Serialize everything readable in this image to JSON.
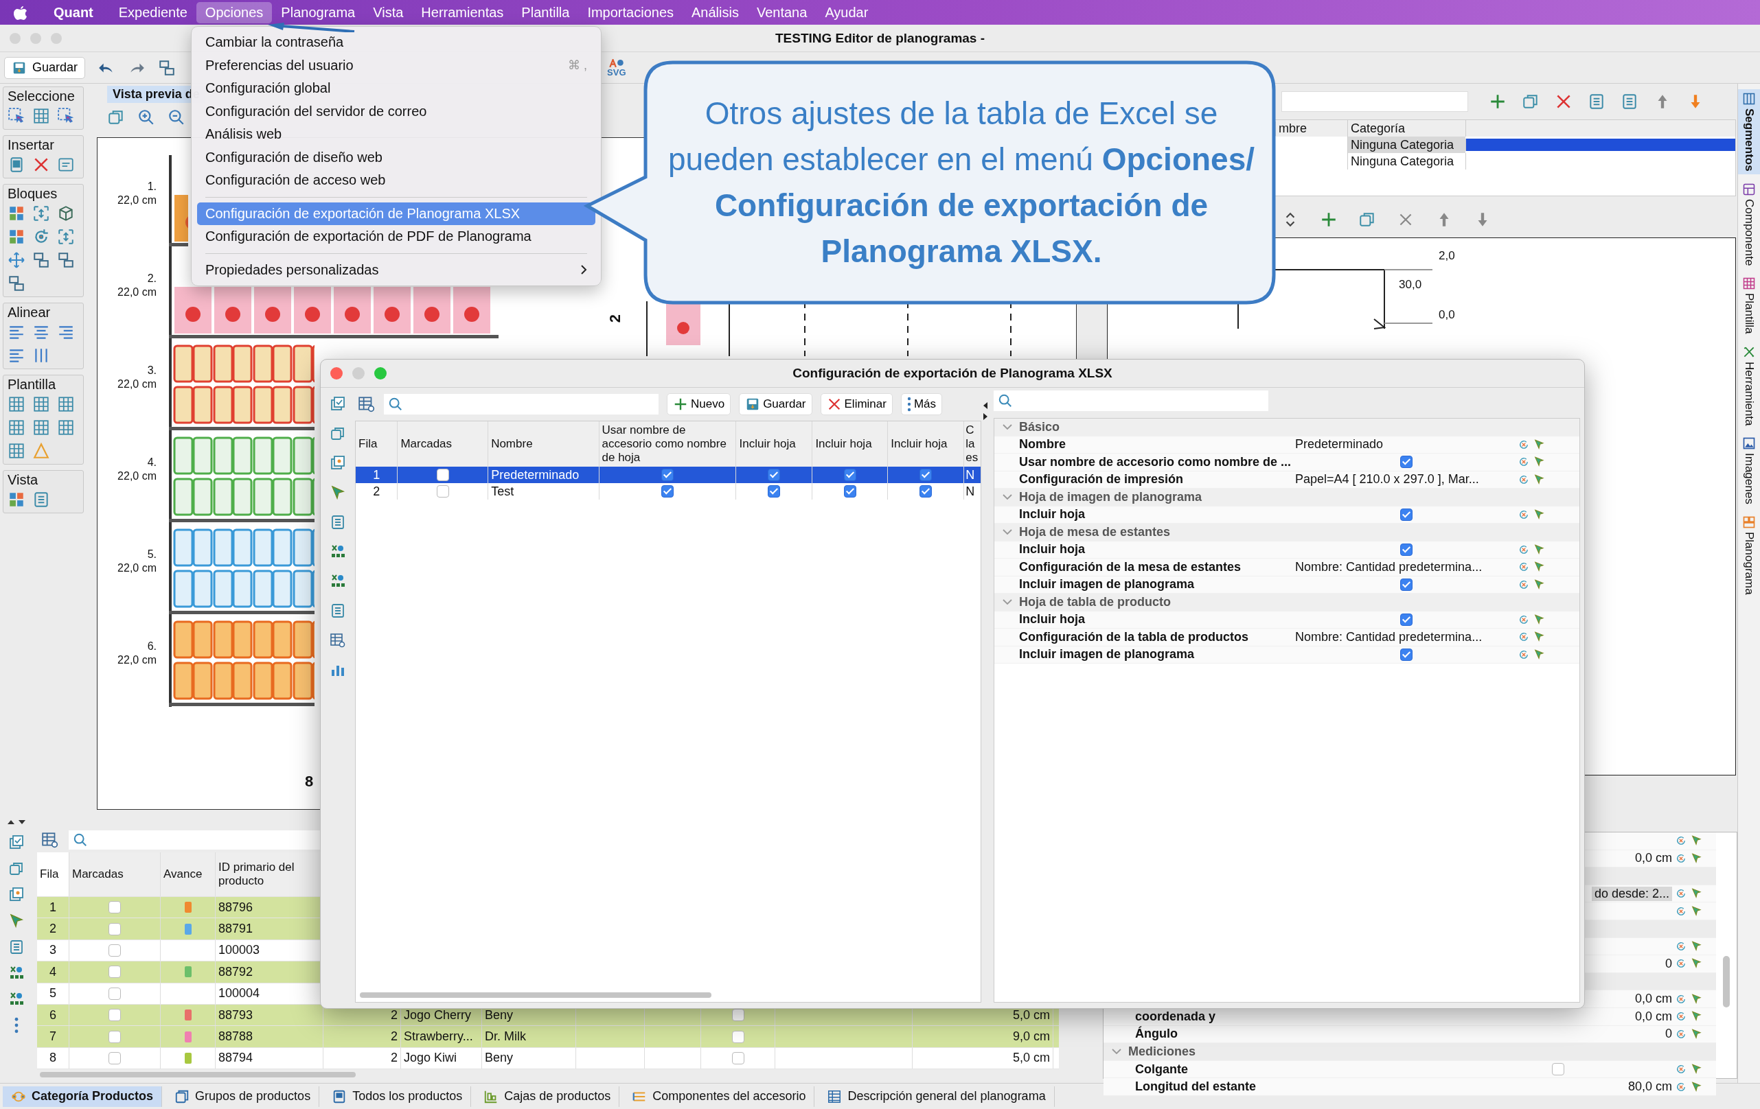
{
  "menu_bar": {
    "app_name": "Quant",
    "items": [
      {
        "label": "Expediente",
        "selected": false
      },
      {
        "label": "Opciones",
        "selected": true
      },
      {
        "label": "Planograma",
        "selected": false
      },
      {
        "label": "Vista",
        "selected": false
      },
      {
        "label": "Herramientas",
        "selected": false
      },
      {
        "label": "Plantilla",
        "selected": false
      },
      {
        "label": "Importaciones",
        "selected": false
      },
      {
        "label": "Análisis",
        "selected": false
      },
      {
        "label": "Ventana",
        "selected": false
      },
      {
        "label": "Ayudar",
        "selected": false
      }
    ]
  },
  "window": {
    "title": "TESTING Editor de planogramas -"
  },
  "toolbar": {
    "save_button": "Guardar",
    "export_badge": "SVG"
  },
  "editor_tab": "Vista previa de",
  "palette": [
    "Seleccione",
    "Insertar",
    "Bloques",
    "Alinear",
    "Plantilla",
    "Vista"
  ],
  "shelves": [
    {
      "number": "1.",
      "height": "22,0 cm",
      "kind": "orange-carton"
    },
    {
      "number": "2.",
      "height": "22,0 cm",
      "kind": "pink-carton"
    },
    {
      "number": "3.",
      "height": "22,0 cm",
      "kind": "red-cup"
    },
    {
      "number": "4.",
      "height": "22,0 cm",
      "kind": "green-cup"
    },
    {
      "number": "5.",
      "height": "22,0 cm",
      "kind": "blue-cup"
    },
    {
      "number": "6.",
      "height": "22,0 cm",
      "kind": "orange-cup"
    }
  ],
  "canvas": {
    "segment_label": "2",
    "width_label": "8"
  },
  "segments_panel": {
    "columns": [
      "mbre",
      "Categoría"
    ],
    "rows": [
      {
        "category": "Ninguna Categoria",
        "selected": true,
        "color": "#1f4fd8"
      },
      {
        "category": "Ninguna Categoria",
        "selected": false
      }
    ]
  },
  "segment_dimensions": [
    "2,0",
    "30,0",
    "0,0"
  ],
  "side_tabs": [
    {
      "label": "Segmentos",
      "selected": true
    },
    {
      "label": "Componente",
      "selected": false
    },
    {
      "label": "Plantilla",
      "selected": false
    },
    {
      "label": "Herramienta",
      "selected": false
    },
    {
      "label": "Imagenes",
      "selected": false
    },
    {
      "label": "Planograma",
      "selected": false
    }
  ],
  "product_table": {
    "columns": [
      "Fila",
      "Marcadas",
      "Avance",
      "ID primario del producto"
    ],
    "rows": [
      {
        "row": "1",
        "marked": false,
        "highlighted": true,
        "color": "#f08a30",
        "id": "88796"
      },
      {
        "row": "2",
        "marked": false,
        "highlighted": true,
        "color": "#5aa8e8",
        "id": "88791"
      },
      {
        "row": "3",
        "marked": false,
        "highlighted": false,
        "id": "100003"
      },
      {
        "row": "4",
        "marked": false,
        "highlighted": true,
        "color": "#6cbf6a",
        "id": "88792"
      },
      {
        "row": "5",
        "marked": false,
        "highlighted": false,
        "id": "100004"
      },
      {
        "row": "6",
        "marked": false,
        "highlighted": true,
        "color": "#e8706a",
        "id": "88793",
        "quantity": "2",
        "name": "Jogo Cherry",
        "brand": "Beny",
        "flag": false,
        "width": "5,0 cm"
      },
      {
        "row": "7",
        "marked": false,
        "highlighted": true,
        "color": "#f080b0",
        "id": "88788",
        "quantity": "2",
        "name": "Strawberry...",
        "brand": "Dr. Milk",
        "flag": false,
        "width": "9,0 cm"
      },
      {
        "row": "8",
        "marked": false,
        "highlighted": false,
        "color": "#a8c840",
        "id": "88794",
        "quantity": "2",
        "name": "Jogo Kiwi",
        "brand": "Beny",
        "flag": false,
        "width": "5,0 cm"
      }
    ]
  },
  "properties_panel": [
    {
      "kind": "empty"
    },
    {
      "kind": "text",
      "value": "0,0 cm"
    },
    {
      "kind": "group"
    },
    {
      "kind": "text",
      "value": "do desde: 2..."
    },
    {
      "kind": "empty"
    },
    {
      "kind": "group"
    },
    {
      "kind": "empty"
    },
    {
      "kind": "text",
      "value": "0"
    },
    {
      "kind": "group"
    },
    {
      "kind": "text",
      "value": "0,0 cm"
    },
    {
      "kind": "text",
      "label": "coordenada y",
      "value": "0,0 cm"
    },
    {
      "kind": "text",
      "label": "Ángulo",
      "value": "0"
    },
    {
      "kind": "group",
      "label": "Mediciones"
    },
    {
      "kind": "check",
      "label": "Colgante",
      "checked": false
    },
    {
      "kind": "text",
      "label": "Longitud del estante",
      "value": "80,0 cm"
    }
  ],
  "bottom_tabs": [
    {
      "label": "Categoría Productos",
      "selected": true
    },
    {
      "label": "Grupos de productos",
      "selected": false
    },
    {
      "label": "Todos los productos",
      "selected": false
    },
    {
      "label": "Cajas de productos",
      "selected": false
    },
    {
      "label": "Componentes del accesorio",
      "selected": false
    },
    {
      "label": "Descripción general del planograma",
      "selected": false
    }
  ],
  "options_menu": {
    "sections": [
      [
        {
          "label": "Cambiar la contraseña",
          "selected": false
        },
        {
          "label": "Preferencias del usuario",
          "shortcut": "⌘ ,",
          "selected": false
        },
        {
          "label": "Configuración global",
          "selected": false
        },
        {
          "label": "Configuración del servidor de correo",
          "selected": false
        },
        {
          "label": "Análisis web",
          "selected": false
        },
        {
          "label": "Configuración de diseño web",
          "selected": false
        },
        {
          "label": "Configuración de acceso web",
          "selected": false
        }
      ],
      [
        {
          "label": "Configuración de exportación de Planograma XLSX",
          "selected": true
        },
        {
          "label": "Configuración de exportación de PDF de Planograma",
          "selected": false
        }
      ],
      [
        {
          "label": "Propiedades personalizadas",
          "submenu": true,
          "selected": false
        }
      ]
    ]
  },
  "dialog": {
    "title": "Configuración de exportación de Planograma XLSX",
    "buttons": [
      {
        "label": "Nuevo",
        "kind": "new"
      },
      {
        "label": "Guardar",
        "kind": "save"
      },
      {
        "label": "Eliminar",
        "kind": "delete"
      },
      {
        "label": "Más",
        "kind": "more"
      }
    ],
    "table": {
      "columns": [
        "Fila",
        "Marcadas",
        "Nombre",
        "Usar nombre de accesorio como nombre de hoja",
        "Incluir hoja",
        "Incluir hoja",
        "Incluir hoja",
        "C la es"
      ],
      "rows": [
        {
          "row": "1",
          "marked": false,
          "name": "Predeterminado",
          "use_name": true,
          "sheets": [
            true,
            true,
            true
          ],
          "cut": "N",
          "selected": true
        },
        {
          "row": "2",
          "marked": false,
          "name": "Test",
          "use_name": true,
          "sheets": [
            true,
            true,
            true
          ],
          "cut": "N",
          "selected": false
        }
      ]
    },
    "properties": [
      {
        "title": "Básico",
        "expanded": true,
        "rows": [
          {
            "label": "Nombre",
            "kind": "text",
            "value": "Predeterminado"
          },
          {
            "label": "Usar nombre de accesorio como nombre de ...",
            "kind": "check",
            "checked": true
          },
          {
            "label": "Configuración de impresión",
            "kind": "text",
            "value": "Papel=A4 [ 210.0 x 297.0 ], Mar..."
          }
        ]
      },
      {
        "title": "Hoja de imagen de planograma",
        "expanded": true,
        "rows": [
          {
            "label": "Incluir hoja",
            "kind": "check",
            "checked": true
          }
        ]
      },
      {
        "title": "Hoja de mesa de estantes",
        "expanded": true,
        "rows": [
          {
            "label": "Incluir hoja",
            "kind": "check",
            "checked": true
          },
          {
            "label": "Configuración de la mesa de estantes",
            "kind": "text",
            "value": "Nombre: Cantidad predetermina..."
          },
          {
            "label": "Incluir imagen de planograma",
            "kind": "check",
            "checked": true
          }
        ]
      },
      {
        "title": "Hoja de tabla de producto",
        "expanded": true,
        "rows": [
          {
            "label": "Incluir hoja",
            "kind": "check",
            "checked": true
          },
          {
            "label": "Configuración de la tabla de productos",
            "kind": "text",
            "value": "Nombre: Cantidad predetermina..."
          },
          {
            "label": "Incluir imagen de planograma",
            "kind": "check",
            "checked": true
          }
        ]
      }
    ]
  },
  "callout": {
    "text": "Otros ajustes de la tabla de Excel se pueden establecer en el menú **Opciones/ Configuración de exportación de Planograma XLSX.**"
  }
}
